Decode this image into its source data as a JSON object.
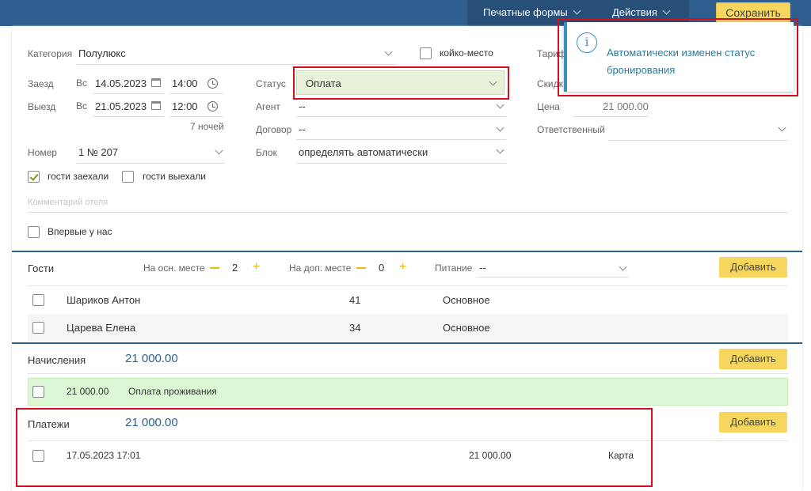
{
  "topbar": {
    "print_forms": "Печатные формы",
    "actions": "Действия",
    "save": "Сохранить"
  },
  "booking": {
    "category_label": "Категория",
    "category_value": "Полулюкс",
    "bed_place_label": "койко-место",
    "tariff_label": "Тариф",
    "checkin_label": "Заезд",
    "checkin_day": "Вс",
    "checkin_date": "14.05.2023",
    "checkin_time": "14:00",
    "checkout_label": "Выезд",
    "checkout_day": "Вс",
    "checkout_date": "21.05.2023",
    "checkout_time": "12:00",
    "nights": "7 ночей",
    "status_label": "Статус",
    "status_value": "Оплата",
    "agent_label": "Агент",
    "agent_value": "--",
    "contract_label": "Договор",
    "contract_value": "--",
    "block_label": "Блок",
    "block_value": "определять автоматически",
    "discount_label": "Скидк",
    "price_label": "Цена",
    "price_value": "21 000.00",
    "responsible_label": "Ответственный",
    "room_label": "Номер",
    "room_value": "1 № 207",
    "guests_checked_in": "гости заехали",
    "guests_checked_out": "гости выехали",
    "hotel_comment_placeholder": "Комментарий отеля",
    "first_time": "Впервые у нас"
  },
  "guests": {
    "title": "Гости",
    "main_place_label": "На осн. месте",
    "main_place_count": "2",
    "extra_place_label": "На доп. месте",
    "extra_place_count": "0",
    "meal_label": "Питание",
    "meal_value": "--",
    "add": "Добавить",
    "rows": [
      {
        "name": "Шариков Антон",
        "age": "41",
        "place": "Основное"
      },
      {
        "name": "Царева Елена",
        "age": "34",
        "place": "Основное"
      }
    ]
  },
  "charges": {
    "title": "Начисления",
    "total": "21 000.00",
    "add": "Добавить",
    "rows": [
      {
        "amount": "21 000.00",
        "description": "Оплата проживания"
      }
    ]
  },
  "payments": {
    "title": "Платежи",
    "total": "21 000.00",
    "add": "Добавить",
    "rows": [
      {
        "datetime": "17.05.2023 17:01",
        "amount": "21 000.00",
        "method": "Карта"
      }
    ]
  },
  "toast": {
    "message": "Автоматически изменен статус бронирования"
  },
  "colors": {
    "topbar": "#2e5f8f",
    "accent_yellow": "#f6d65c",
    "status_bg": "#e8f1da",
    "charge_row_bg": "#dcf7d4",
    "highlight_red": "#d0101e"
  }
}
